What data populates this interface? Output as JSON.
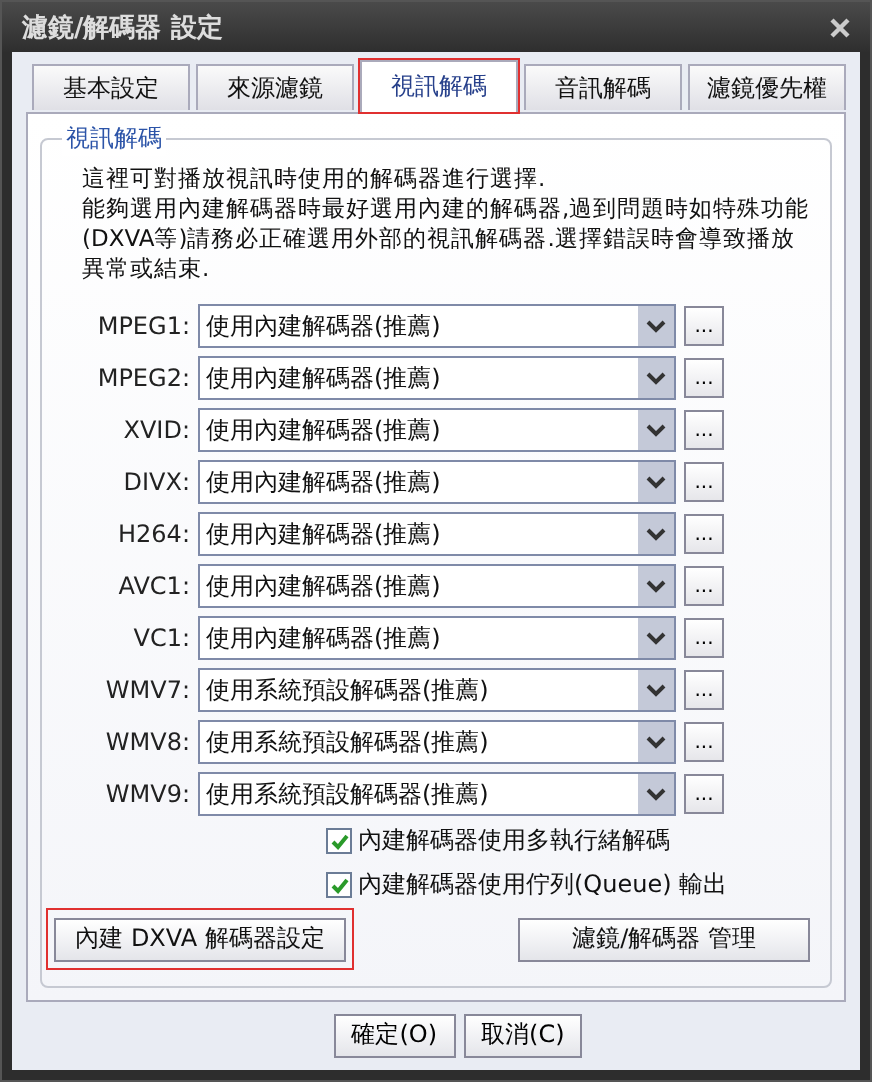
{
  "window": {
    "title": "濾鏡/解碼器 設定"
  },
  "tabs": [
    {
      "label": "基本設定",
      "selected": false
    },
    {
      "label": "來源濾鏡",
      "selected": false
    },
    {
      "label": "視訊解碼",
      "selected": true
    },
    {
      "label": "音訊解碼",
      "selected": false
    },
    {
      "label": "濾鏡優先權",
      "selected": false
    }
  ],
  "group": {
    "title": "視訊解碼",
    "description": [
      "這裡可對播放視訊時使用的解碼器進行選擇.",
      "能夠選用內建解碼器時最好選用內建的解碼器,過到問題時如特殊功能",
      "(DXVA等)請務必正確選用外部的視訊解碼器.選擇錯誤時會導致播放",
      "異常或結束."
    ]
  },
  "decoders": [
    {
      "label": "MPEG1:",
      "value": "使用內建解碼器(推薦)",
      "more": "..."
    },
    {
      "label": "MPEG2:",
      "value": "使用內建解碼器(推薦)",
      "more": "..."
    },
    {
      "label": "XVID:",
      "value": "使用內建解碼器(推薦)",
      "more": "..."
    },
    {
      "label": "DIVX:",
      "value": "使用內建解碼器(推薦)",
      "more": "..."
    },
    {
      "label": "H264:",
      "value": "使用內建解碼器(推薦)",
      "more": "..."
    },
    {
      "label": "AVC1:",
      "value": "使用內建解碼器(推薦)",
      "more": "..."
    },
    {
      "label": "VC1:",
      "value": "使用內建解碼器(推薦)",
      "more": "..."
    },
    {
      "label": "WMV7:",
      "value": "使用系統預設解碼器(推薦)",
      "more": "..."
    },
    {
      "label": "WMV8:",
      "value": "使用系統預設解碼器(推薦)",
      "more": "..."
    },
    {
      "label": "WMV9:",
      "value": "使用系統預設解碼器(推薦)",
      "more": "..."
    }
  ],
  "options": [
    {
      "label": "內建解碼器使用多執行緒解碼",
      "checked": true
    },
    {
      "label": "內建解碼器使用佇列(Queue) 輸出",
      "checked": true
    }
  ],
  "actions": [
    {
      "label": "內建 DXVA 解碼器設定",
      "highlighted": true
    },
    {
      "label": "濾鏡/解碼器 管理",
      "highlighted": false
    }
  ],
  "footer_buttons": [
    "確定(O)",
    "取消(C)"
  ]
}
